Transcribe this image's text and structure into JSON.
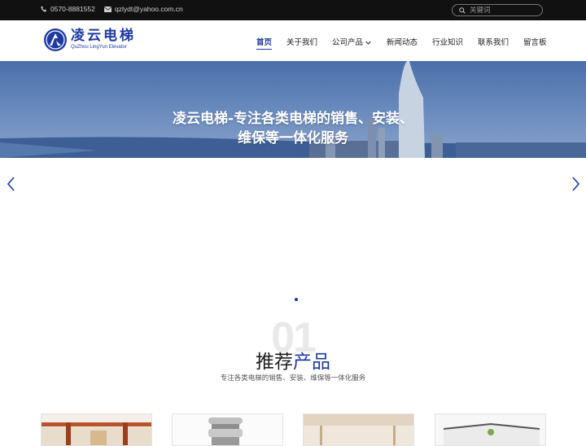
{
  "topbar": {
    "phone": "0570-8881552",
    "email": "qzlydt@yahoo.com.cn",
    "search_placeholder": "关键词",
    "icons": [
      "phone-icon",
      "envelope-icon",
      "search-icon"
    ]
  },
  "logo": {
    "name_cn": "凌云电梯",
    "name_en": "QuZhou LingYun Elevator"
  },
  "nav": {
    "items": [
      {
        "label": "首页",
        "active": true
      },
      {
        "label": "关于我们",
        "active": false
      },
      {
        "label": "公司产品",
        "active": false,
        "dropdown": true
      },
      {
        "label": "新闻动态",
        "active": false
      },
      {
        "label": "行业知识",
        "active": false
      },
      {
        "label": "联系我们",
        "active": false
      },
      {
        "label": "留言板",
        "active": false
      }
    ]
  },
  "banner": {
    "line1": "凌云电梯-专注各类电梯的销售、安装、",
    "line2": "维保等一体化服务"
  },
  "slider": {
    "prev_icon": "chevron-left-icon",
    "next_icon": "chevron-right-icon"
  },
  "section": {
    "number": "01",
    "title_part1": "推荐",
    "title_part2": "产品",
    "subtitle": "专注各类电梯的销售、安装、维保等一体化服务"
  },
  "colors": {
    "accent": "#1e3aa0",
    "topbar_bg": "#111111",
    "text": "#222222"
  }
}
